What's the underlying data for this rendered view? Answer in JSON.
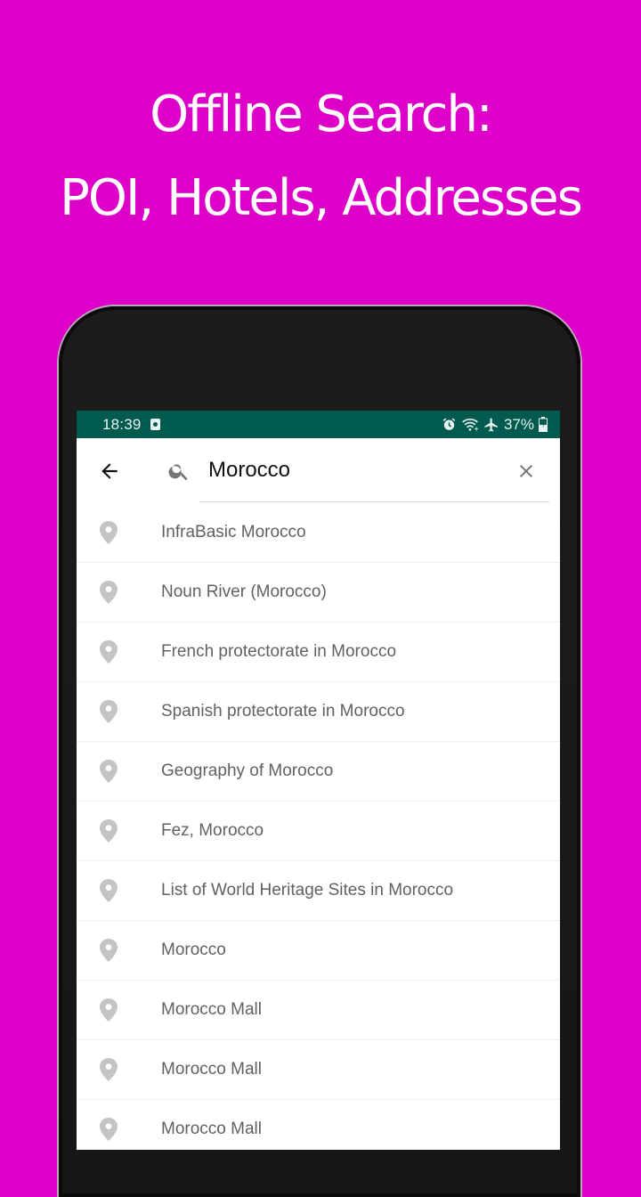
{
  "headline": {
    "line1": "Offline Search:",
    "line2": "POI, Hotels, Addresses"
  },
  "colors": {
    "background": "#dc00c8",
    "status_bar": "#005b4e",
    "pin_icon": "#c4c4c4",
    "result_text": "#616161"
  },
  "status_bar": {
    "time": "18:39",
    "battery": "37%",
    "icons": [
      "app-notification-icon",
      "alarm-icon",
      "wifi-icon",
      "airplane-mode-icon",
      "battery-charging-icon"
    ]
  },
  "search": {
    "back_icon": "arrow-left-icon",
    "search_icon": "magnifier-icon",
    "query": "Morocco",
    "clear_icon": "close-icon"
  },
  "results": [
    {
      "label": "InfraBasic Morocco",
      "icon": "map-pin-icon"
    },
    {
      "label": "Noun River (Morocco)",
      "icon": "map-pin-icon"
    },
    {
      "label": "French protectorate in Morocco",
      "icon": "map-pin-icon"
    },
    {
      "label": "Spanish protectorate in Morocco",
      "icon": "map-pin-icon"
    },
    {
      "label": "Geography of Morocco",
      "icon": "map-pin-icon"
    },
    {
      "label": "Fez, Morocco",
      "icon": "map-pin-icon"
    },
    {
      "label": "List of World Heritage Sites in Morocco",
      "icon": "map-pin-icon"
    },
    {
      "label": "Morocco",
      "icon": "map-pin-icon"
    },
    {
      "label": "Morocco Mall",
      "icon": "map-pin-icon"
    },
    {
      "label": "Morocco Mall",
      "icon": "map-pin-icon"
    },
    {
      "label": "Morocco Mall",
      "icon": "map-pin-icon"
    }
  ]
}
